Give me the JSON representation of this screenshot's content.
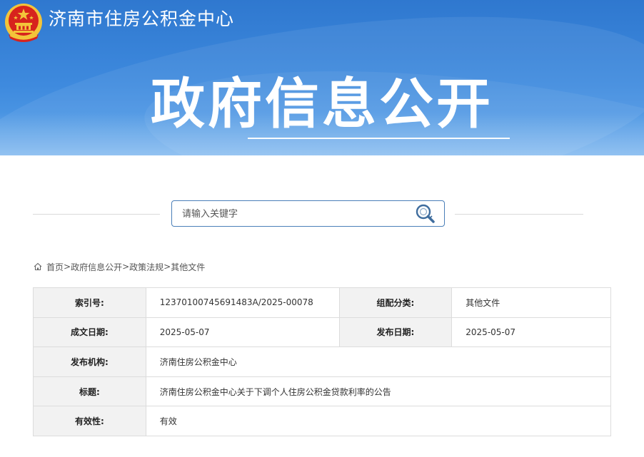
{
  "header": {
    "site_name": "济南市住房公积金中心",
    "banner_title": "政府信息公开",
    "colors": {
      "banner": "#3e8ade",
      "emblem_red": "#d7231d",
      "emblem_gold": "#f3c43a"
    }
  },
  "search": {
    "placeholder": "请输入关键字",
    "value": "",
    "icon": "search-icon",
    "border_color": "#4a7fb8"
  },
  "breadcrumb": {
    "icon": "home-icon",
    "items": [
      "首页",
      "政府信息公开",
      "政策法规",
      "其他文件"
    ],
    "separator": ">"
  },
  "info": {
    "index_label": "索引号:",
    "index_value": "12370100745691483A/2025-00078",
    "category_label": "组配分类:",
    "category_value": "其他文件",
    "created_label": "成文日期:",
    "created_value": "2025-05-07",
    "published_label": "发布日期:",
    "published_value": "2025-05-07",
    "publisher_label": "发布机构:",
    "publisher_value": "济南住房公积金中心",
    "title_label": "标题:",
    "title_value": "济南住房公积金中心关于下调个人住房公积金贷款利率的公告",
    "validity_label": "有效性:",
    "validity_value": "有效"
  }
}
